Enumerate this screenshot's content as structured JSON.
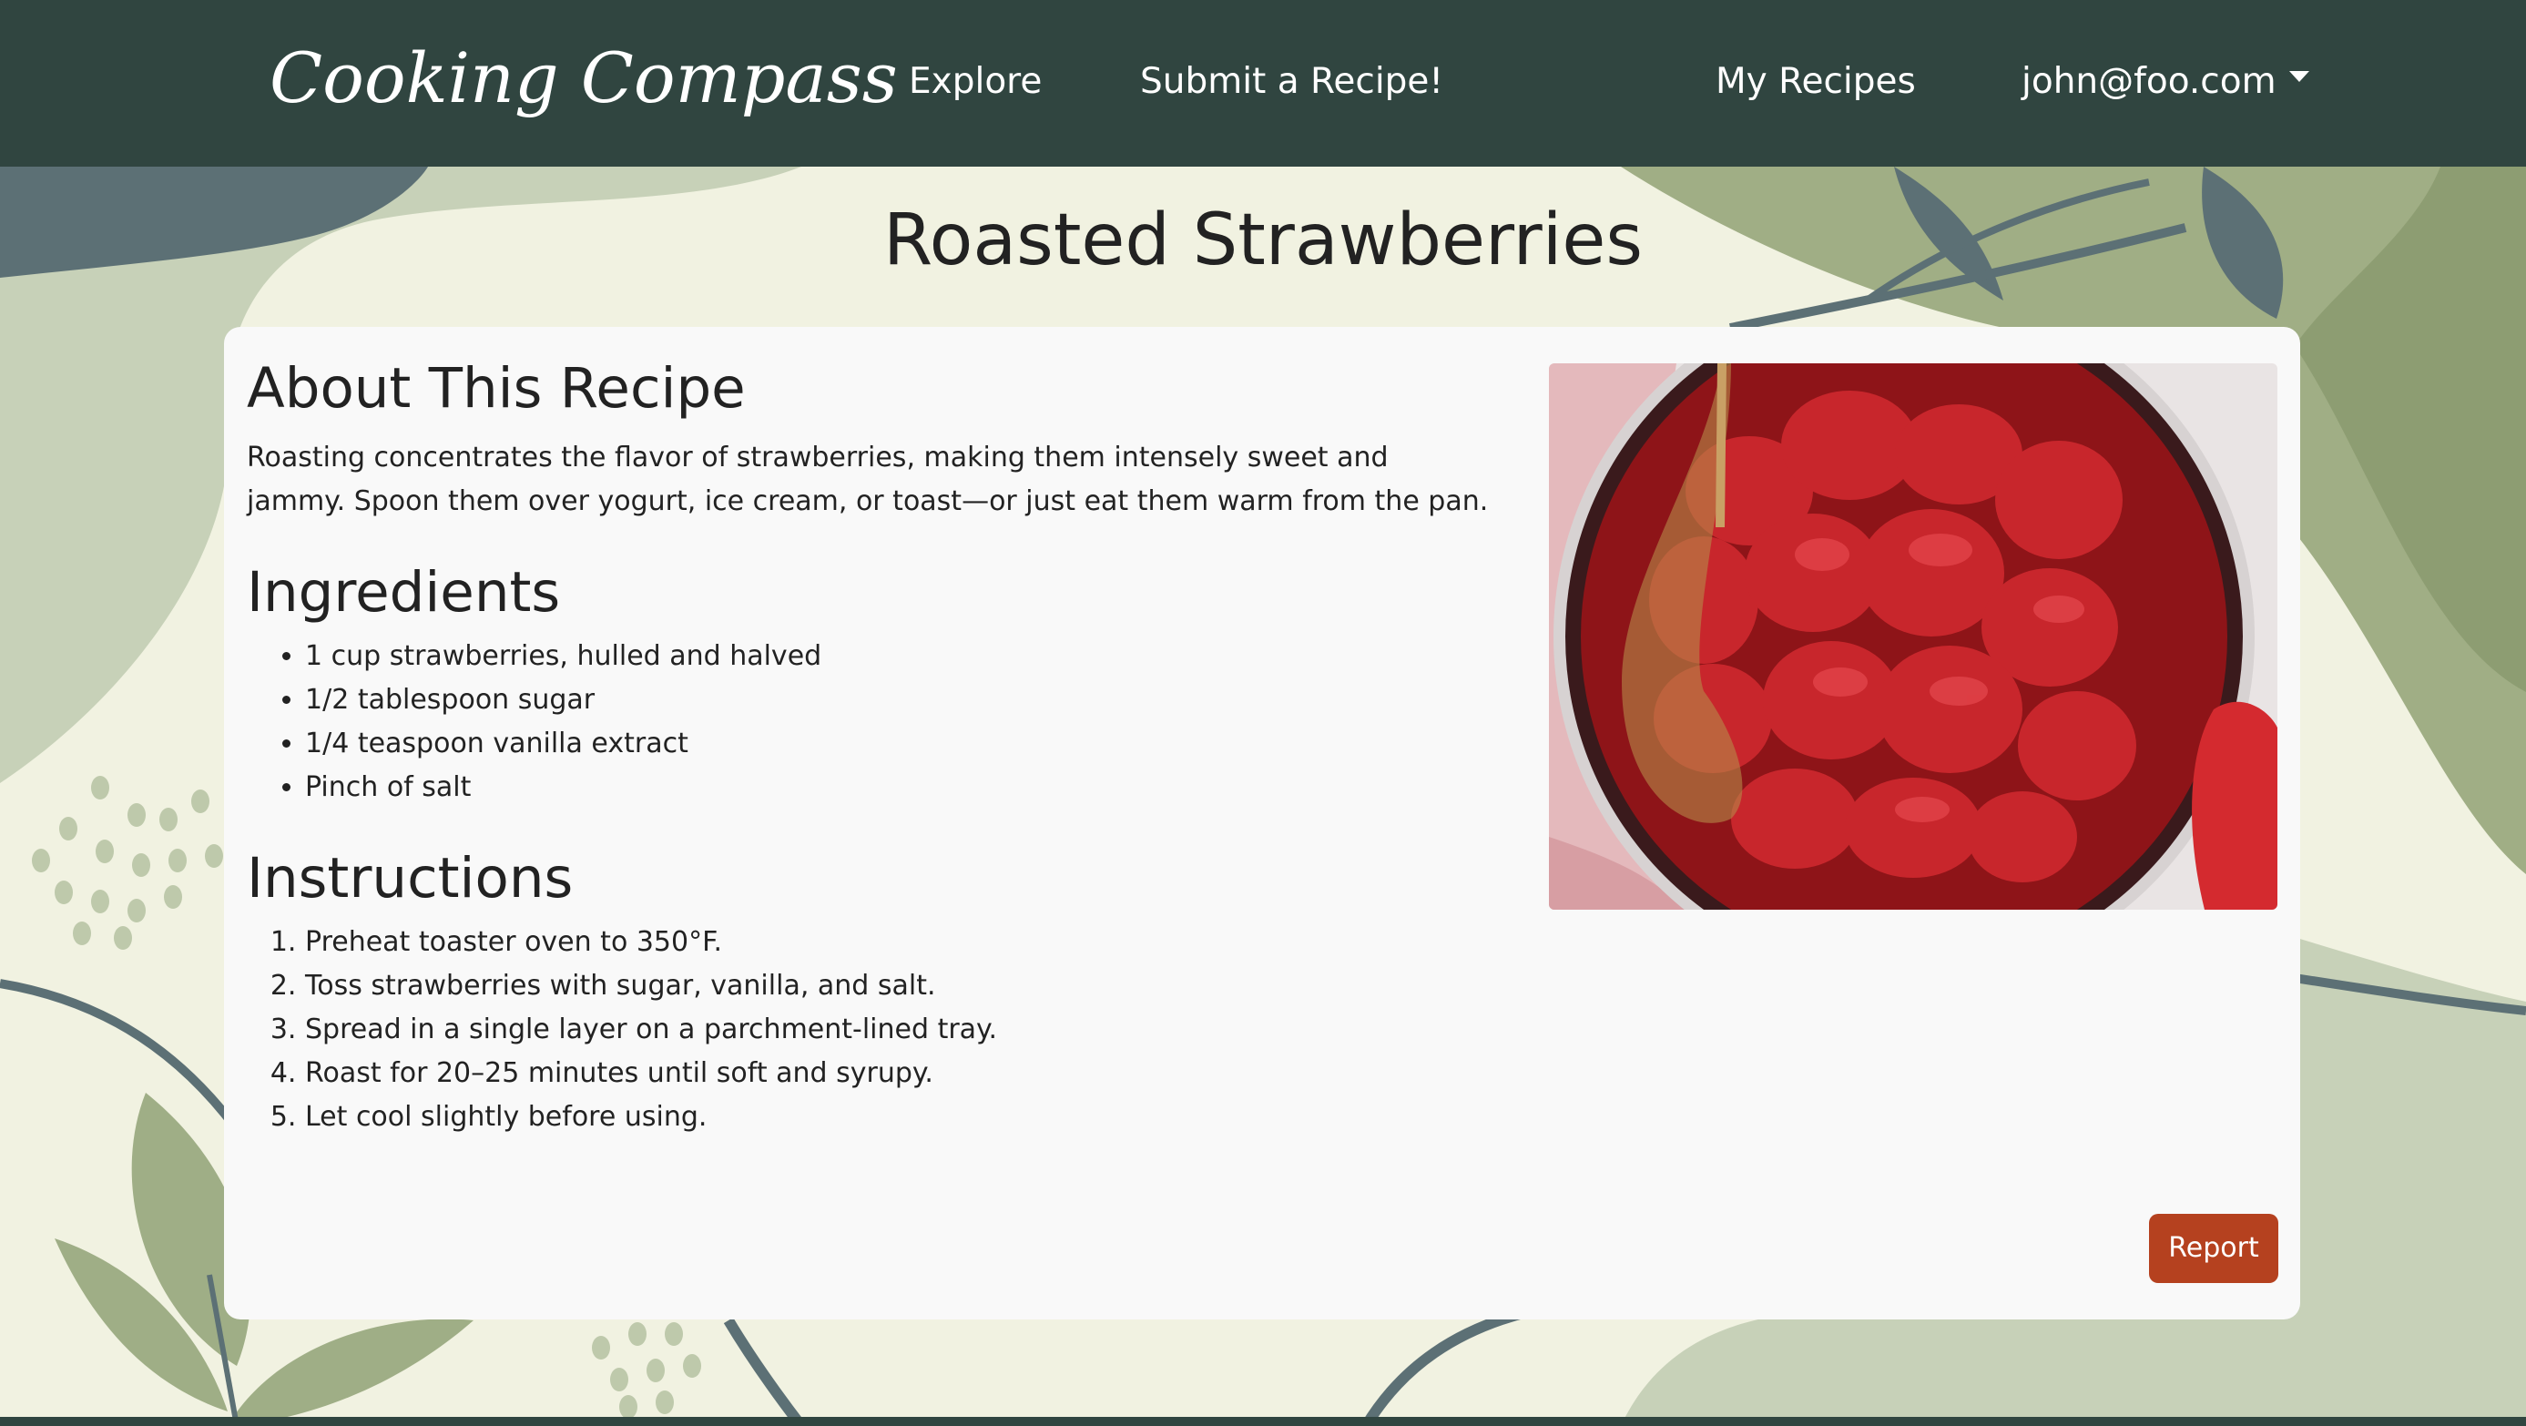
{
  "navbar": {
    "brand": "Cooking Compass",
    "explore": "Explore",
    "submit": "Submit a Recipe!",
    "my_recipes": "My Recipes",
    "user_email": "john@foo.com"
  },
  "recipe": {
    "title": "Roasted Strawberries",
    "about_heading": "About This Recipe",
    "about_text": "Roasting concentrates the flavor of strawberries, making them intensely sweet and jammy. Spoon them over yogurt, ice cream, or toast—or just eat them warm from the pan.",
    "ingredients_heading": "Ingredients",
    "ingredients": [
      "1 cup strawberries, hulled and halved",
      "1/2 tablespoon sugar",
      "1/4 teaspoon vanilla extract",
      "Pinch of salt"
    ],
    "instructions_heading": "Instructions",
    "instructions": [
      "Preheat toaster oven to 350°F.",
      "Toss strawberries with sugar, vanilla, and salt.",
      "Spread in a single layer on a parchment-lined tray.",
      "Roast for 20–25 minutes until soft and syrupy.",
      "Let cool slightly before using."
    ],
    "report_label": "Report"
  },
  "colors": {
    "navbar": "#304540",
    "page_background": "#f1f2e1",
    "card": "#f9f9f9",
    "report_button": "#b5411f",
    "leaf_green": "#9fae86",
    "leaf_slate": "#5c7075"
  },
  "icons": {
    "user_menu": "caret-down-icon"
  }
}
